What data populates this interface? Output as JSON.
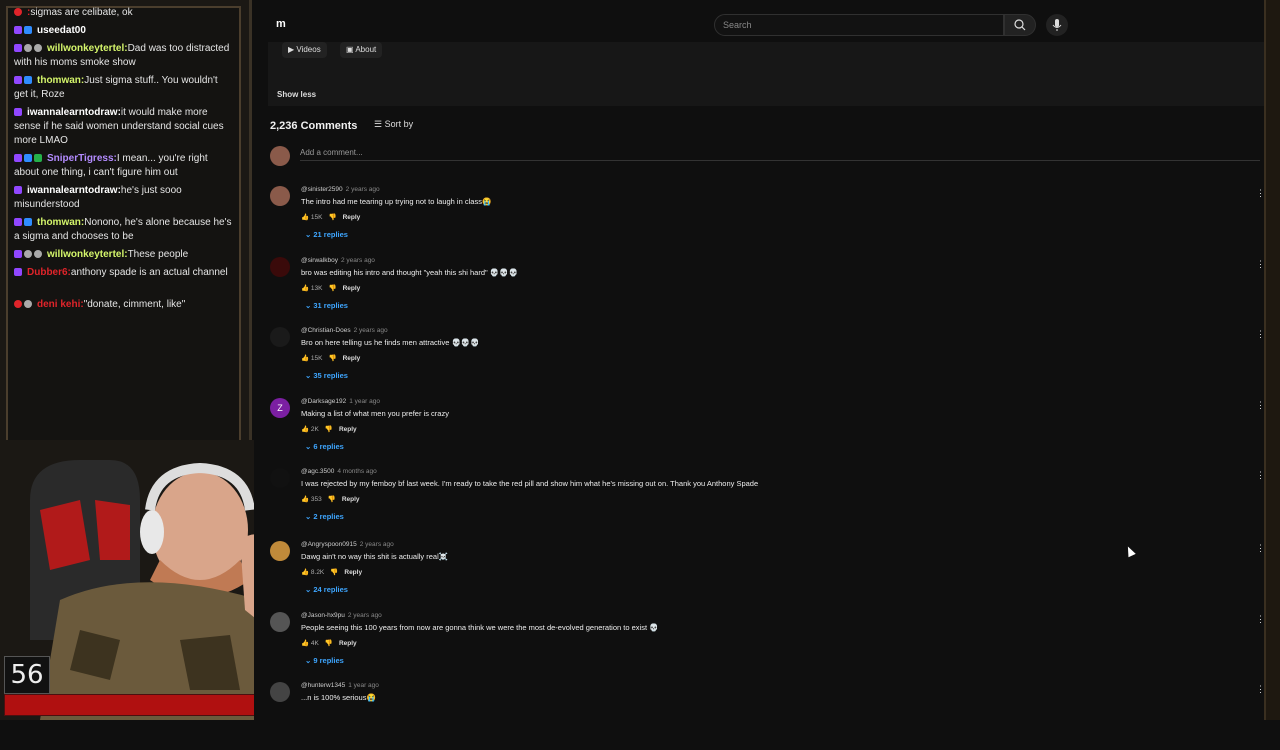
{
  "chat": {
    "messages": [
      {
        "badges": [
          "red"
        ],
        "user": "",
        "text": "sigmas are celibate, ok",
        "user_color": "#e0242a"
      },
      {
        "badges": [
          "purple",
          "blue"
        ],
        "user": "useedat00",
        "text": "",
        "user_color": "#ffffff"
      },
      {
        "badges": [
          "purple",
          "gray",
          "gray"
        ],
        "user": "willwonkeytertel",
        "text": "Dad was too distracted with his moms smoke show",
        "user_color": "#d4f56b"
      },
      {
        "badges": [
          "purple",
          "blue"
        ],
        "user": "thomwan",
        "text": "Just sigma stuff.. You wouldn't get it, Roze",
        "user_color": "#d4f56b"
      },
      {
        "badges": [
          "purple"
        ],
        "user": "iwannalearntodraw",
        "text": "it would make more sense if he said women understand social cues more LMAO",
        "user_color": "#ffffff"
      },
      {
        "badges": [
          "purple",
          "blue",
          "green"
        ],
        "user": "SniperTigress",
        "text": "I mean... you're right about one thing, i can't figure him out",
        "user_color": "#b38bff"
      },
      {
        "badges": [
          "purple"
        ],
        "user": "iwannalearntodraw",
        "text": "he's just sooo misunderstood",
        "user_color": "#ffffff"
      },
      {
        "badges": [
          "purple",
          "blue"
        ],
        "user": "thomwan",
        "text": "Nonono, he's alone because he's a sigma and chooses to be",
        "user_color": "#d4f56b"
      },
      {
        "badges": [
          "purple",
          "gray",
          "gray"
        ],
        "user": "willwonkeytertel",
        "text": "These people",
        "user_color": "#d4f56b"
      },
      {
        "badges": [
          "purple"
        ],
        "user": "Dubber6",
        "text": "anthony spade is an actual channel",
        "user_color": "#e0242a"
      },
      {
        "badges": [
          "red",
          "gray"
        ],
        "user": "deni kehi",
        "text": "\"donate, cimment, like\"",
        "user_color": "#e0242a"
      }
    ]
  },
  "stream": {
    "viewer_number": "56"
  },
  "youtube": {
    "logo": "m",
    "search_placeholder": "Search",
    "tabs": [
      "Videos",
      "About"
    ],
    "show_less": "Show less",
    "comments_count": "2,236 Comments",
    "sort_by": "Sort by",
    "add_comment": "Add a comment...",
    "comments": [
      {
        "user": "@sinister2590",
        "time": "2 years ago",
        "text": "The intro had me tearing up trying not to laugh in class😭",
        "likes": "15K",
        "replies": "21 replies",
        "avatar": "#8a5a4a"
      },
      {
        "user": "@sirwalkboy",
        "time": "2 years ago",
        "text": "bro was editing his intro and thought \"yeah this shi hard\" 💀💀💀",
        "likes": "13K",
        "replies": "31 replies",
        "avatar": "#3a0a0a"
      },
      {
        "user": "@Christian-Does",
        "time": "2 years ago",
        "text": "Bro on here telling us he finds men attractive 💀💀💀",
        "likes": "15K",
        "replies": "35 replies",
        "avatar": "#1a1a1a"
      },
      {
        "user": "@Darksage192",
        "time": "1 year ago",
        "text": "Making a list of what men you prefer is crazy",
        "likes": "2K",
        "replies": "6 replies",
        "avatar": "#7b1fa2",
        "avatar_letter": "Z"
      },
      {
        "user": "@agc.3500",
        "time": "4 months ago",
        "text": "I was rejected by my femboy bf last week. I'm ready to take the red pill and show him what he's missing out on. Thank you Anthony Spade",
        "likes": "353",
        "replies": "2 replies",
        "avatar": "#111111"
      },
      {
        "user": "@Angryspoon0915",
        "time": "2 years ago",
        "text": "Dawg ain't no way this shit is actually real☠️",
        "likes": "8.2K",
        "replies": "24 replies",
        "avatar": "#c08a3a"
      },
      {
        "user": "@Jason-hx9pu",
        "time": "2 years ago",
        "text": "People seeing this 100 years from now are gonna think we were the most de-evolved generation to exist 💀",
        "likes": "4K",
        "replies": "9 replies",
        "avatar": "#555555"
      },
      {
        "user": "@hunterw1345",
        "time": "1 year ago",
        "text": "...n is 100% serious😭",
        "likes": "",
        "replies": "",
        "avatar": "#444444"
      }
    ],
    "reply_label": "Reply"
  }
}
